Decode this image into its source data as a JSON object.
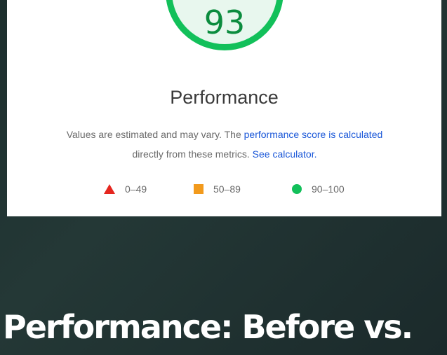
{
  "report": {
    "score": "93",
    "title": "Performance",
    "desc_prefix": "Values are estimated and may vary. The ",
    "desc_link": "performance score is calculated",
    "desc_middle": " directly from these metrics. ",
    "desc_link2": "See calculator.",
    "legend": [
      {
        "label": "0–49",
        "icon": "red-triangle-icon",
        "color": "#e5261f"
      },
      {
        "label": "50–89",
        "icon": "orange-square-icon",
        "color": "#f29a1c"
      },
      {
        "label": "90–100",
        "icon": "green-circle-icon",
        "color": "#12c05a"
      }
    ]
  },
  "headline": "Performance: Before vs.",
  "colors": {
    "background": "#1d2f2e",
    "gauge_green": "#12c05a",
    "link_blue": "#1a57d8"
  }
}
